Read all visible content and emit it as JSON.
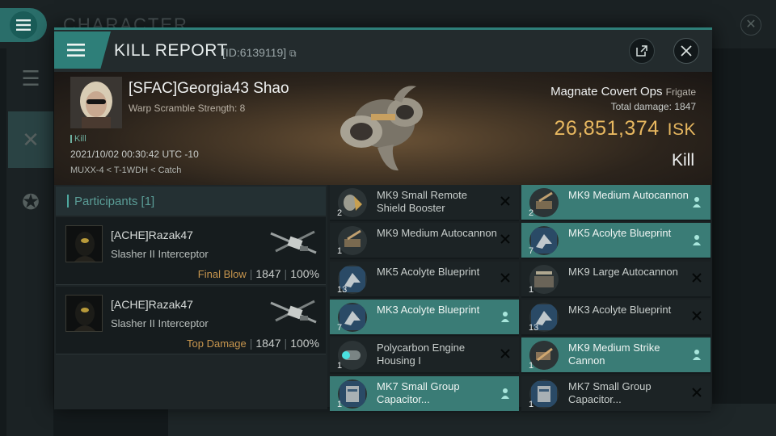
{
  "background": {
    "title": "CHARACTER"
  },
  "modal": {
    "title": "KILL REPORT",
    "id_label": "[ID:6139119]"
  },
  "victim": {
    "name": "[SFAC]Georgia43 Shao",
    "warp_scramble": "Warp Scramble Strength: 8",
    "kill_tag": "Kill",
    "timestamp": "2021/10/02 00:30:42 UTC -10",
    "location": "MUXX-4 < T-1WDH < Catch",
    "ship_name": "Magnate Covert Ops",
    "ship_class": "Frigate",
    "total_damage_label": "Total damage:",
    "total_damage_value": "1847",
    "isk_value": "26,851,374",
    "isk_unit": "ISK",
    "result": "Kill"
  },
  "participants": {
    "header": "Participants [1]",
    "rows": [
      {
        "name": "[ACHE]Razak47",
        "ship": "Slasher II Interceptor",
        "role": "Final Blow",
        "damage": "1847",
        "percent": "100%"
      },
      {
        "name": "[ACHE]Razak47",
        "ship": "Slasher II Interceptor",
        "role": "Top Damage",
        "damage": "1847",
        "percent": "100%"
      }
    ]
  },
  "items_left": [
    {
      "qty": "2",
      "name": "MK9 Small Remote Shield Booster",
      "highlight": false,
      "flag": "destroyed",
      "icon": "shield-booster-icon"
    },
    {
      "qty": "1",
      "name": "MK9 Medium Autocannon",
      "highlight": false,
      "flag": "destroyed",
      "icon": "autocannon-icon"
    },
    {
      "qty": "13",
      "name": "MK5 Acolyte Blueprint",
      "highlight": false,
      "flag": "destroyed",
      "icon": "blueprint-icon"
    },
    {
      "qty": "7",
      "name": "MK3 Acolyte Blueprint",
      "highlight": true,
      "flag": "dropped",
      "icon": "blueprint-icon"
    },
    {
      "qty": "1",
      "name": "Polycarbon Engine Housing I",
      "highlight": false,
      "flag": "destroyed",
      "icon": "engine-housing-icon"
    },
    {
      "qty": "1",
      "name": "MK7 Small Group Capacitor...",
      "highlight": true,
      "flag": "dropped",
      "icon": "capacitor-icon"
    }
  ],
  "items_right": [
    {
      "qty": "2",
      "name": "MK9 Medium Autocannon",
      "highlight": true,
      "flag": "dropped",
      "icon": "autocannon-icon"
    },
    {
      "qty": "7",
      "name": "MK5 Acolyte Blueprint",
      "highlight": true,
      "flag": "dropped",
      "icon": "blueprint-icon"
    },
    {
      "qty": "1",
      "name": "MK9 Large Autocannon",
      "highlight": false,
      "flag": "destroyed",
      "icon": "large-autocannon-icon"
    },
    {
      "qty": "13",
      "name": "MK3 Acolyte Blueprint",
      "highlight": false,
      "flag": "destroyed",
      "icon": "blueprint-icon"
    },
    {
      "qty": "1",
      "name": "MK9 Medium Strike Cannon",
      "highlight": true,
      "flag": "dropped",
      "icon": "strike-cannon-icon"
    },
    {
      "qty": "1",
      "name": "MK7 Small Group Capacitor...",
      "highlight": false,
      "flag": "destroyed",
      "icon": "capacitor-icon"
    }
  ],
  "colors": {
    "accent": "#2e7f79",
    "highlight_row": "#3a7c76",
    "isk": "#e8b860",
    "final_blow": "#c8964e"
  }
}
